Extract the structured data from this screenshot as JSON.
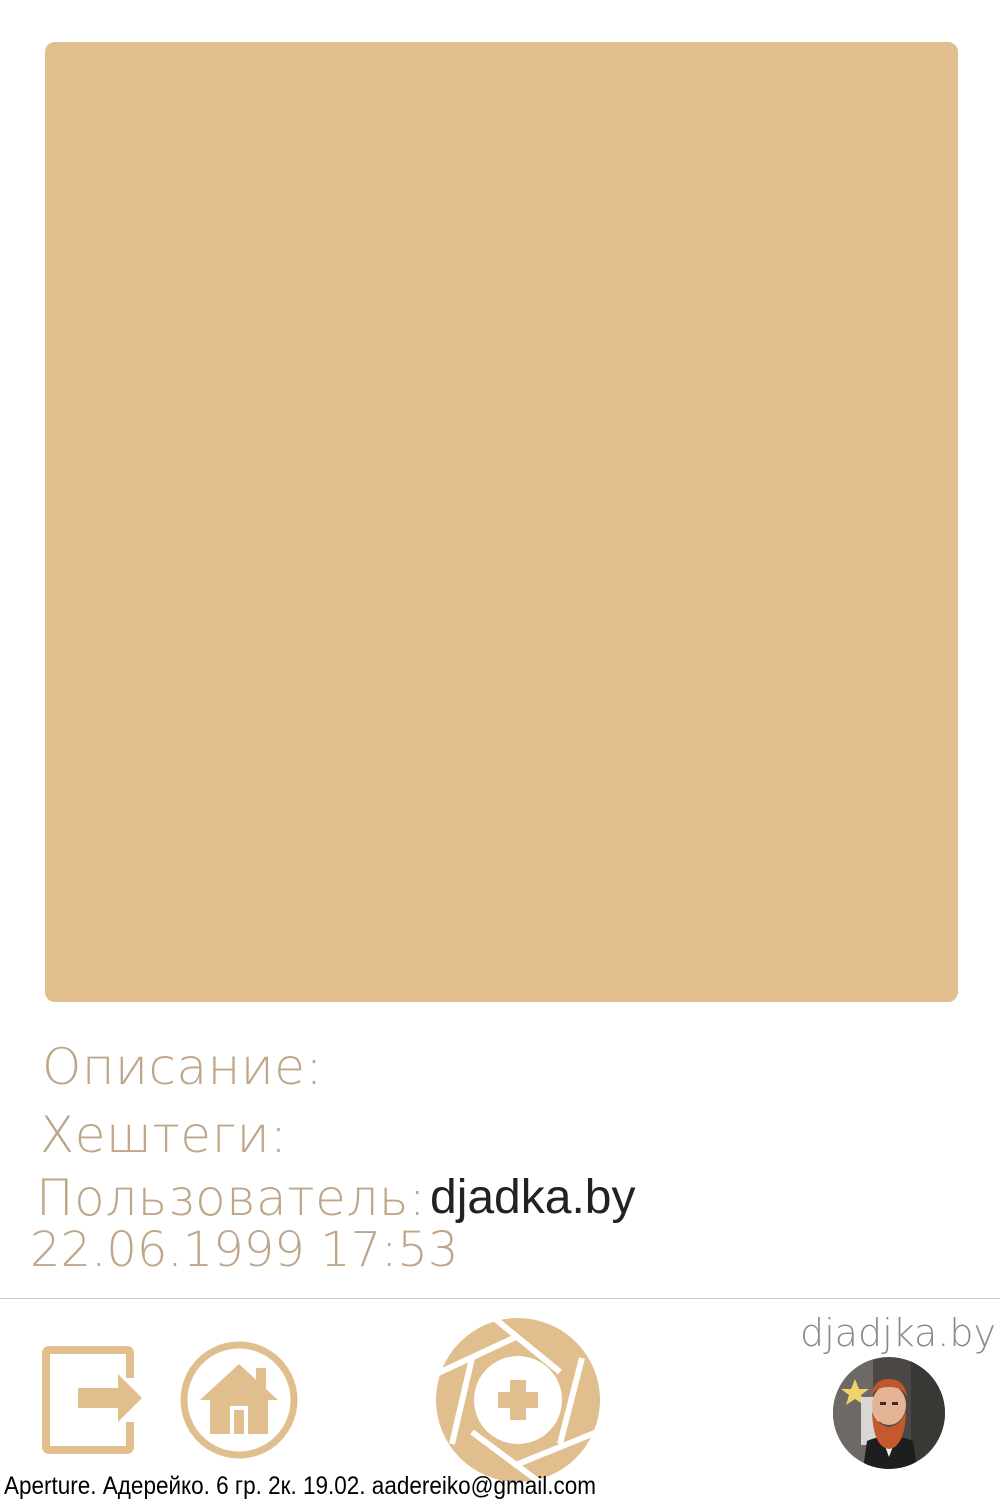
{
  "post": {
    "description_label": "Описание:",
    "hashtags_label": "Хештеги:",
    "user_label": "Пользователь:",
    "user_name": "djadka.by",
    "datetime": "22.06.1999 17:53"
  },
  "nav": {
    "brand": "djadjka.by"
  },
  "footer": {
    "text": "Aperture. Адерейко. 6 гр. 2к. 19.02. aadereiko@gmail.com"
  },
  "colors": {
    "accent": "#e1be8d",
    "label": "#bfa688",
    "brand": "#8a8a8a"
  },
  "icons": {
    "logout": "logout-icon",
    "home": "home-icon",
    "add_photo": "aperture-plus-icon",
    "avatar": "user-avatar"
  }
}
